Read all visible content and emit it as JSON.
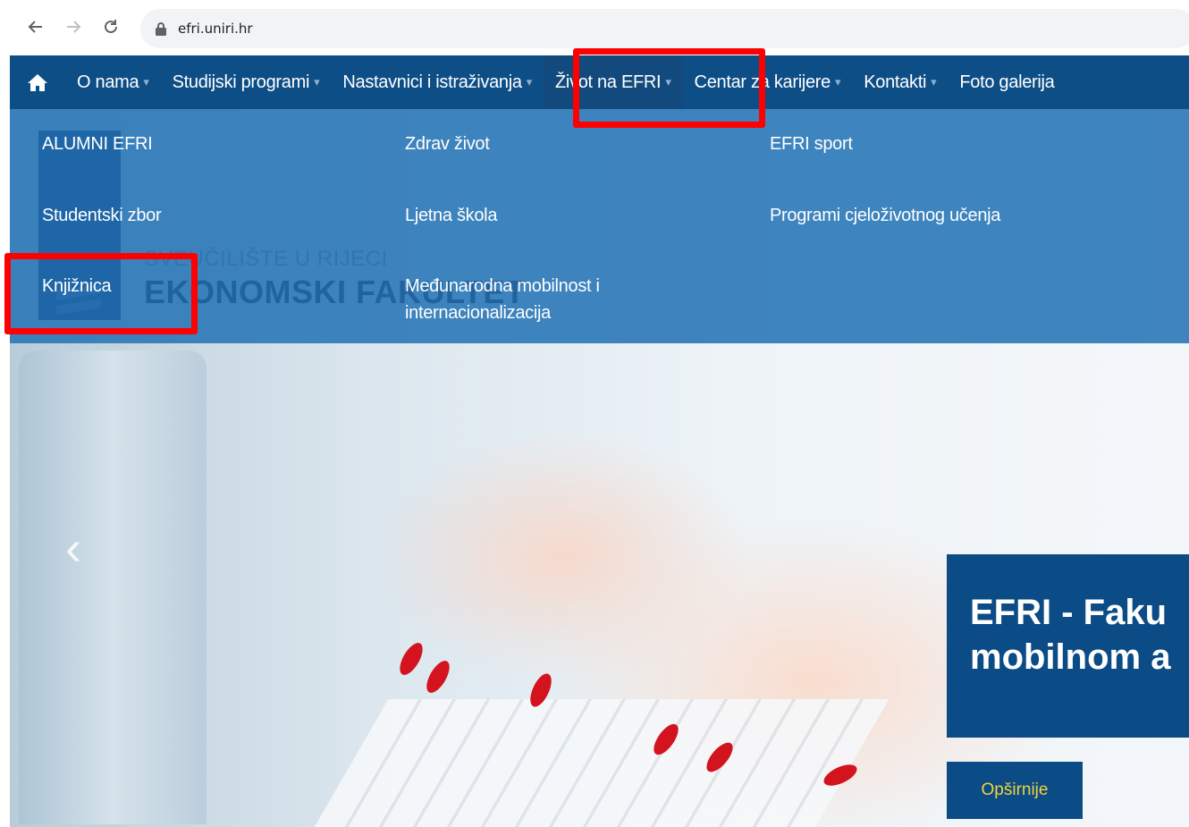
{
  "browser": {
    "url": "efri.uniri.hr"
  },
  "nav": {
    "items": [
      {
        "label": "O nama",
        "dropdown": true
      },
      {
        "label": "Studijski programi",
        "dropdown": true
      },
      {
        "label": "Nastavnici i istraživanja",
        "dropdown": true
      },
      {
        "label": "Život na EFRI",
        "dropdown": true,
        "active": true
      },
      {
        "label": "Centar za karijere",
        "dropdown": true
      },
      {
        "label": "Kontakti",
        "dropdown": true
      },
      {
        "label": "Foto galerija",
        "dropdown": false
      }
    ],
    "caret": "▾"
  },
  "dropdown": {
    "col1": [
      "ALUMNI EFRI",
      "Studentski zbor",
      "Knjižnica"
    ],
    "col2": [
      "Zdrav život",
      "Ljetna škola",
      "Međunarodna mobilnost i",
      "internacionalizacija"
    ],
    "col3": [
      "EFRI sport",
      "Programi cjeloživotnog učenja"
    ]
  },
  "logo": {
    "line1": "SVEUČILIŠTE U RIJECI",
    "line2": "EKONOMSKI FAKULTET"
  },
  "slide": {
    "title_line1": "EFRI - Faku",
    "title_line2": "mobilnom a",
    "button": "Opširnije"
  },
  "colors": {
    "nav_bg": "#0e4e86",
    "dropdown_bg": "#2f79b8",
    "caption_bg": "#0b4b86",
    "button_text": "#f2d33a",
    "highlight": "#ff0000"
  }
}
